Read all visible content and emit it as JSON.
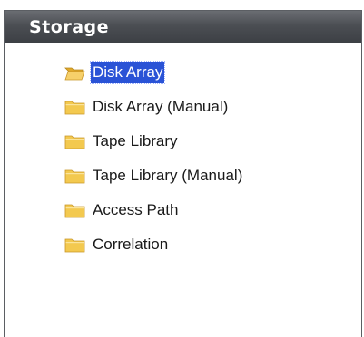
{
  "panel": {
    "title": "Storage"
  },
  "tree": {
    "items": [
      {
        "label": "Disk Array",
        "icon": "folder-open-icon",
        "selected": true
      },
      {
        "label": "Disk Array (Manual)",
        "icon": "folder-icon",
        "selected": false
      },
      {
        "label": "Tape Library",
        "icon": "folder-icon",
        "selected": false
      },
      {
        "label": "Tape Library (Manual)",
        "icon": "folder-icon",
        "selected": false
      },
      {
        "label": "Access Path",
        "icon": "folder-icon",
        "selected": false
      },
      {
        "label": "Correlation",
        "icon": "folder-icon",
        "selected": false
      }
    ]
  },
  "colors": {
    "header_bg": "#4b4e53",
    "selection_bg": "#2a53d6",
    "folder_yellow": "#f3c94f"
  }
}
